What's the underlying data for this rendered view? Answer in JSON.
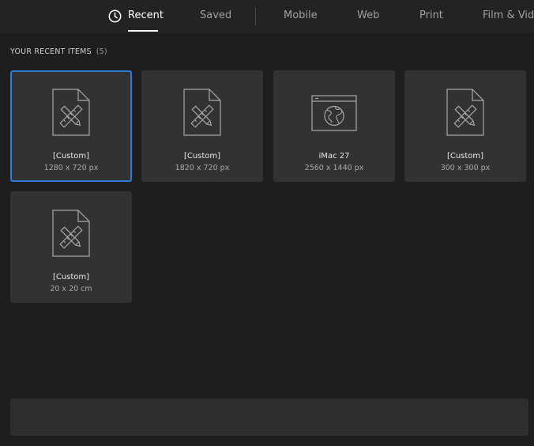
{
  "tabs": {
    "recent": "Recent",
    "saved": "Saved",
    "mobile": "Mobile",
    "web": "Web",
    "print": "Print",
    "film": "Film & Video"
  },
  "active_tab": "recent",
  "section": {
    "title": "YOUR RECENT ITEMS",
    "count": "(5)"
  },
  "items": [
    {
      "name": "[Custom]",
      "size": "1280 x 720 px",
      "icon": "document-pencil-ruler-icon",
      "selected": true
    },
    {
      "name": "[Custom]",
      "size": "1820 x 720 px",
      "icon": "document-pencil-ruler-icon",
      "selected": false
    },
    {
      "name": "iMac 27",
      "size": "2560 x 1440 px",
      "icon": "browser-globe-icon",
      "selected": false
    },
    {
      "name": "[Custom]",
      "size": "300 x 300 px",
      "icon": "document-pencil-ruler-icon",
      "selected": false
    },
    {
      "name": "[Custom]",
      "size": "20 x 20 cm",
      "icon": "document-pencil-ruler-icon",
      "selected": false
    }
  ],
  "colors": {
    "background": "#1e1e1e",
    "card": "#323232",
    "selection": "#2f7bd9"
  }
}
